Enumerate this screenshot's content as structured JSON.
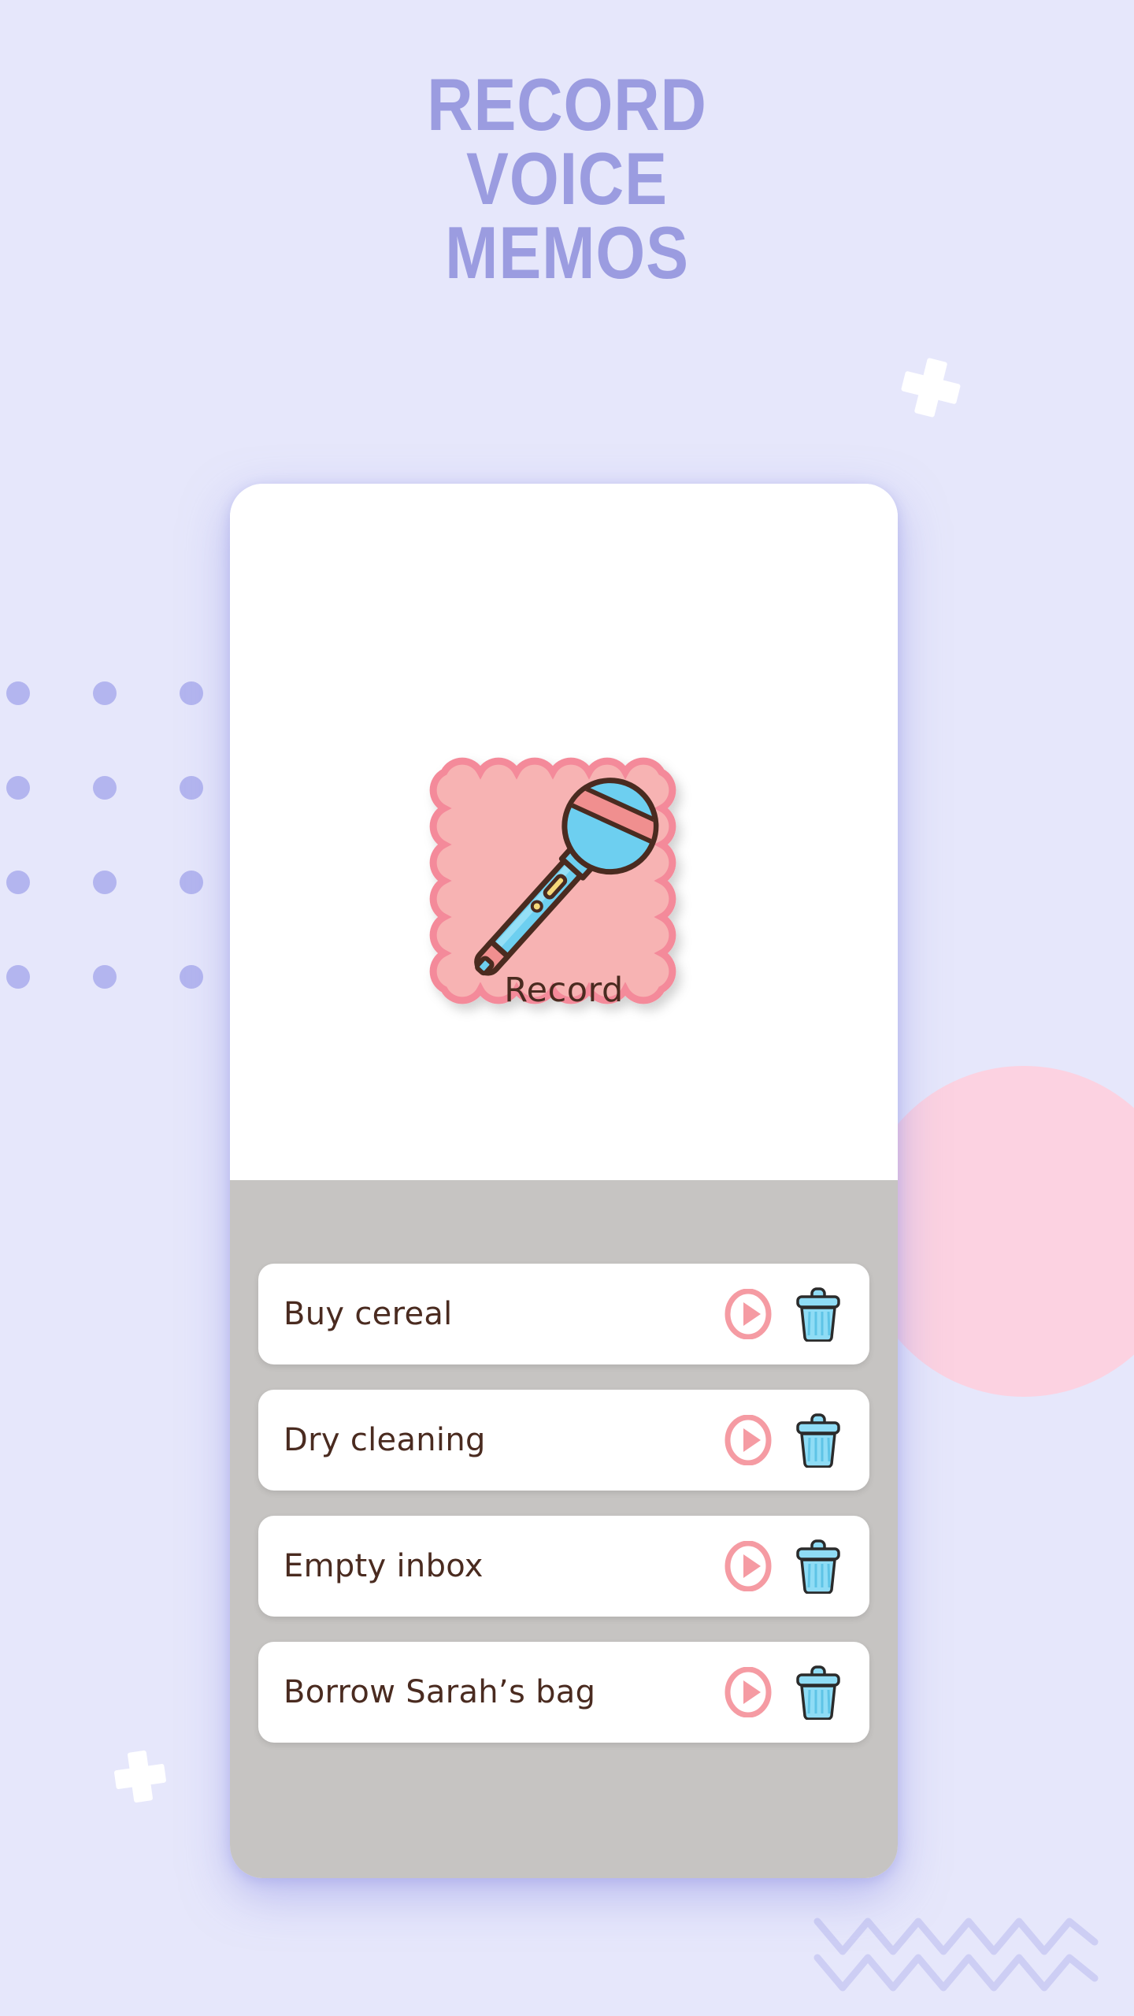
{
  "headline": {
    "line1": "RECORD",
    "line2": "VOICE",
    "line3": "MEMOS"
  },
  "colors": {
    "background": "#e6e7fb",
    "headline_text": "#9b9ce0",
    "dot": "#b3b5ef",
    "decor_plus": "#ffffff",
    "zigzag": "#cdcef4",
    "pink_circle": "#fcd2e1",
    "phone_screen_top": "#ffffff",
    "phone_screen_bottom": "#c6c4c2",
    "record_tile": "#f7b3b3",
    "record_tile_border": "#f48a9a",
    "mic_body": "#6dcff0",
    "mic_band": "#f08f8f",
    "mic_outline": "#4a2b20",
    "mic_detail": "#f5d97a",
    "play_icon": "#f59ba3",
    "trash_icon": "#8fdcf5",
    "trash_outline": "#2b2b2b",
    "text_dark": "#4a2b20"
  },
  "phone": {
    "record_button": {
      "label": "Record",
      "icon": "microphone-icon"
    },
    "memos": [
      {
        "title": "Buy cereal",
        "play_icon": "play-icon",
        "delete_icon": "trash-icon"
      },
      {
        "title": "Dry cleaning",
        "play_icon": "play-icon",
        "delete_icon": "trash-icon"
      },
      {
        "title": "Empty inbox",
        "play_icon": "play-icon",
        "delete_icon": "trash-icon"
      },
      {
        "title": "Borrow Sarah’s bag",
        "play_icon": "play-icon",
        "delete_icon": "trash-icon"
      }
    ]
  },
  "decor": {
    "dot_grid": {
      "columns": 3,
      "rows": 4,
      "count": 12
    },
    "plus_top_right": "plus-icon",
    "plus_bottom_left": "plus-icon",
    "zigzag_rows": 2,
    "circle": "pink-circle"
  }
}
